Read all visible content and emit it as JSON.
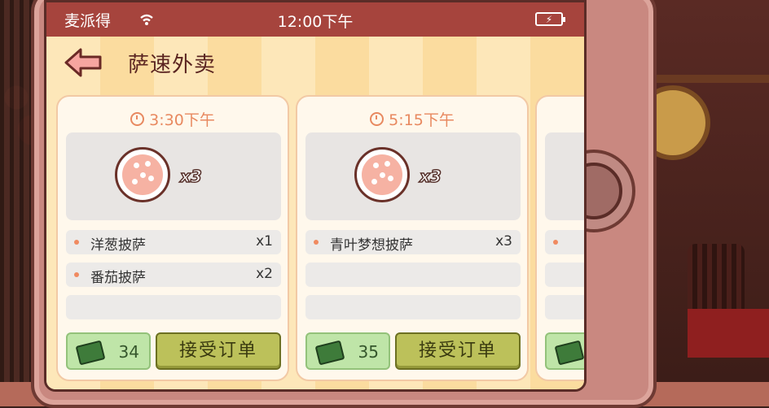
{
  "status_bar": {
    "carrier": "麦派得",
    "time": "12:00下午",
    "battery_icon": "battery-charging-icon",
    "wifi_icon": "wifi-icon"
  },
  "header": {
    "title": "萨速外卖",
    "back_icon": "back-arrow-icon"
  },
  "orders": [
    {
      "time": "3:30下午",
      "pizza_qty": "x3",
      "items": [
        {
          "name": "洋葱披萨",
          "count": "x1"
        },
        {
          "name": "番茄披萨",
          "count": "x2"
        },
        {
          "name": "",
          "count": ""
        }
      ],
      "reward": "34",
      "accept_label": "接受订单"
    },
    {
      "time": "5:15下午",
      "pizza_qty": "x3",
      "items": [
        {
          "name": "青叶梦想披萨",
          "count": "x3"
        },
        {
          "name": "",
          "count": ""
        },
        {
          "name": "",
          "count": ""
        }
      ],
      "reward": "35",
      "accept_label": "接受订单"
    }
  ],
  "colors": {
    "status_bar": "#a6443d",
    "accent_time": "#e88960",
    "accept_button": "#bcc15a",
    "money_box": "#bfe5a8"
  }
}
